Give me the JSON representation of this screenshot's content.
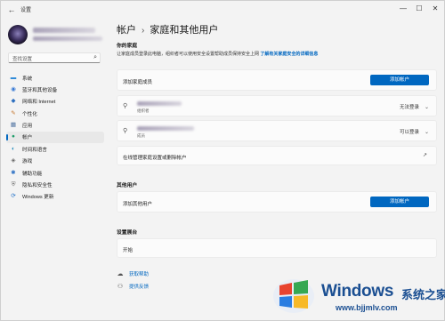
{
  "titlebar": {
    "back": "←",
    "title": "设置",
    "minimize": "—",
    "maximize": "☐",
    "close": "✕"
  },
  "sidebar": {
    "search_placeholder": "查找设置",
    "items": [
      {
        "label": "系统",
        "icon": "▬",
        "color": "#2f8ad8"
      },
      {
        "label": "蓝牙和其他设备",
        "icon": "◉",
        "color": "#3a7bd5"
      },
      {
        "label": "网络和 Internet",
        "icon": "◆",
        "color": "#2d6fbf"
      },
      {
        "label": "个性化",
        "icon": "✎",
        "color": "#c4742a"
      },
      {
        "label": "应用",
        "icon": "▦",
        "color": "#4a6f9e"
      },
      {
        "label": "帐户",
        "icon": "●",
        "color": "#1f9e6a"
      },
      {
        "label": "时间和语言",
        "icon": "◐",
        "color": "#2a8fbf"
      },
      {
        "label": "游戏",
        "icon": "◈",
        "color": "#6b6b6b"
      },
      {
        "label": "辅助功能",
        "icon": "✱",
        "color": "#2a6fc4"
      },
      {
        "label": "隐私和安全性",
        "icon": "⛨",
        "color": "#6b6b6b"
      },
      {
        "label": "Windows 更新",
        "icon": "⟳",
        "color": "#1f6fc8"
      }
    ],
    "active_index": 5
  },
  "breadcrumb": {
    "parent": "帐户",
    "separator": "›",
    "current": "家庭和其他用户"
  },
  "family": {
    "heading": "你的家庭",
    "description": "让家庭成员登录此电脑，组织者可以使用安全设置帮助成员保持安全上网",
    "link": "了解有关家庭安全的详细信息",
    "add_label": "添加家庭成员",
    "add_button": "添加帐户",
    "members": [
      {
        "role": "组织者",
        "status": "无法登录"
      },
      {
        "role": "成员",
        "status": "可以登录"
      }
    ],
    "manage_label": "在线管理家庭设置或删除帐户"
  },
  "other_users": {
    "heading": "其他用户",
    "add_label": "添加其他用户",
    "add_button": "添加帐户"
  },
  "kiosk": {
    "heading": "设置展台",
    "label": "开始"
  },
  "help": {
    "get_help": "获取帮助",
    "feedback": "提供反馈"
  },
  "watermark": {
    "brand": "Windows",
    "cn": "系统之家",
    "url": "www.bjjmlv.com"
  }
}
